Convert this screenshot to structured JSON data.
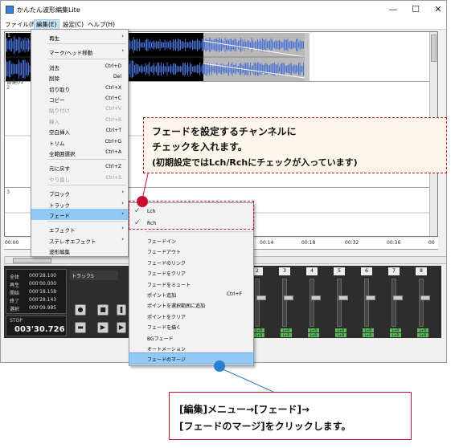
{
  "window": {
    "title": "かんたん波形編集Lite",
    "controls": {
      "minimize": "—",
      "maximize": "☐",
      "close": "✕"
    }
  },
  "menubar": [
    "ファイル(F)",
    "編集(E)",
    "設定(C)",
    "ヘルプ(H)"
  ],
  "tracks": {
    "clip_label": "音楽01",
    "numbers": [
      "1",
      "2",
      "3"
    ]
  },
  "ruler": [
    "00:00",
    "00:14",
    "00:18",
    "00:32",
    "00:36",
    "00"
  ],
  "transport": {
    "rows": [
      {
        "label": "全体",
        "value": "000'28.100"
      },
      {
        "label": "再生",
        "value": "000'00.000"
      },
      {
        "label": "開始",
        "value": "000'18.158"
      },
      {
        "label": "終了",
        "value": "000'28.143"
      },
      {
        "label": "選択",
        "value": "000'09.985"
      }
    ],
    "state": "STOP",
    "time": "003'30.726",
    "track_select": "トラック5"
  },
  "mixer": {
    "channels": [
      "2",
      "3",
      "4",
      "5",
      "6",
      "7",
      "8"
    ],
    "lr_label": "L+R"
  },
  "edit_menu": [
    {
      "label": "再生",
      "shortcut": "",
      "arrow": "›",
      "disabled": false
    },
    {
      "sep": true
    },
    {
      "label": "マーク/ヘッド移動",
      "shortcut": "",
      "arrow": "›",
      "disabled": false
    },
    {
      "sep": true
    },
    {
      "label": "消去",
      "shortcut": "Ctrl+D",
      "disabled": false
    },
    {
      "label": "削除",
      "shortcut": "Del",
      "disabled": false
    },
    {
      "label": "切り取り",
      "shortcut": "Ctrl+X",
      "disabled": false
    },
    {
      "label": "コピー",
      "shortcut": "Ctrl+C",
      "disabled": false
    },
    {
      "label": "貼り付け",
      "shortcut": "Ctrl+V",
      "disabled": true
    },
    {
      "label": "挿入",
      "shortcut": "Ctrl+B",
      "disabled": true
    },
    {
      "label": "空白挿入",
      "shortcut": "Ctrl+T",
      "disabled": false
    },
    {
      "label": "トリム",
      "shortcut": "Ctrl+G",
      "disabled": false
    },
    {
      "label": "全範囲選択",
      "shortcut": "Ctrl+A",
      "disabled": false
    },
    {
      "sep": true
    },
    {
      "label": "元に戻す",
      "shortcut": "Ctrl+Z",
      "disabled": false
    },
    {
      "label": "やり直し",
      "shortcut": "Ctrl+S",
      "disabled": true
    },
    {
      "sep": true
    },
    {
      "label": "ブロック",
      "shortcut": "",
      "arrow": "›",
      "disabled": false
    },
    {
      "label": "トラック",
      "shortcut": "",
      "arrow": "›",
      "disabled": false
    },
    {
      "label": "フェード",
      "shortcut": "",
      "arrow": "›",
      "disabled": false,
      "highlight": true
    },
    {
      "sep": true
    },
    {
      "label": "エフェクト",
      "shortcut": "",
      "arrow": "›",
      "disabled": false
    },
    {
      "label": "ステレオエフェクト",
      "shortcut": "",
      "arrow": "›",
      "disabled": false
    },
    {
      "label": "波形編集",
      "shortcut": "",
      "disabled": false
    }
  ],
  "fade_menu": [
    {
      "label": "Lch",
      "checked": true
    },
    {
      "label": "Rch",
      "checked": true
    },
    {
      "sep": true
    },
    {
      "label": "フェードイン"
    },
    {
      "label": "フェードアウト"
    },
    {
      "label": "フェードのリンク"
    },
    {
      "label": "フェードをクリア"
    },
    {
      "label": "フェードをミュート"
    },
    {
      "label": "ポイント追加",
      "shortcut": "Ctrl+F"
    },
    {
      "label": "ポイントを選択範囲に追加"
    },
    {
      "label": "ポイントをクリア"
    },
    {
      "label": "フェードを描く"
    },
    {
      "label": "BGフェード"
    },
    {
      "label": "オートメーション"
    },
    {
      "label": "フェードのマージ",
      "highlight": true
    }
  ],
  "callout_top": [
    "フェードを設定するチャンネルに",
    "チェックを入れます。",
    "(初期設定ではLch/Rchにチェックが入っています)"
  ],
  "callout_bottom": [
    "[編集]メニュー→[フェード]→",
    "[フェードのマージ]をクリックします。"
  ],
  "colors": {
    "accent_red": "#c8102e",
    "wave_blue": "#4a72d6",
    "highlight": "#91c9f7"
  }
}
